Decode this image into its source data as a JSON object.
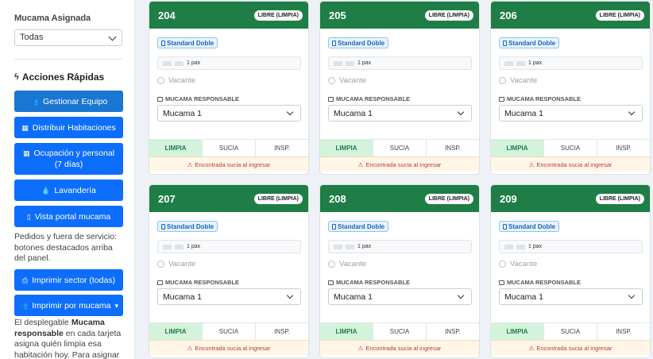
{
  "sidebar": {
    "filter_label": "Mucama Asignada",
    "filter_value": "Todas",
    "quick_actions_title": "Acciones Rápidas",
    "buttons": {
      "gestionar": "Gestionar Equipo",
      "distribuir": "Distribuir Habitaciones",
      "ocupacion_l1": "Ocupación y personal",
      "ocupacion_l2": "(7 días)",
      "lavanderia": "Lavandería",
      "portal": "Vista portal mucama",
      "imprimir_sector": "Imprimir sector (todas)",
      "imprimir_mucama": "Imprimir por mucama"
    },
    "note1": "Pedidos y fuera de servicio: botones destacados arriba del panel.",
    "note2_prefix": "El desplegable ",
    "note2_bold": "Mucama responsable",
    "note2_suffix": " en cada tarjeta asigna quién limpia esa habitación hoy. Para asignar"
  },
  "cards": [
    {
      "room": "204",
      "status": "LIBRE (LIMPIA)",
      "type": "Standard Doble",
      "pax": "1 pax",
      "vacante": "Vacante",
      "resp_label": "MUCAMA RESPONSABLE",
      "resp_value": "Mucama 1",
      "tab1": "LIMPIA",
      "tab2": "SUCIA",
      "tab3": "INSP.",
      "warning": "Encontrada sucia al ingresar"
    },
    {
      "room": "205",
      "status": "LIBRE (LIMPIA)",
      "type": "Standard Doble",
      "pax": "1 pax",
      "vacante": "Vacante",
      "resp_label": "MUCAMA RESPONSABLE",
      "resp_value": "Mucama 1",
      "tab1": "LIMPIA",
      "tab2": "SUCIA",
      "tab3": "INSP.",
      "warning": "Encontrada sucia al ingresar"
    },
    {
      "room": "206",
      "status": "LIBRE (LIMPIA)",
      "type": "Standard Doble",
      "pax": "1 pax",
      "vacante": "Vacante",
      "resp_label": "MUCAMA RESPONSABLE",
      "resp_value": "Mucama 1",
      "tab1": "LIMPIA",
      "tab2": "SUCIA",
      "tab3": "INSP.",
      "warning": "Encontrada sucia al ingresar"
    },
    {
      "room": "207",
      "status": "LIBRE (LIMPIA)",
      "type": "Standard Doble",
      "pax": "1 pax",
      "vacante": "Vacante",
      "resp_label": "MUCAMA RESPONSABLE",
      "resp_value": "Mucama 1",
      "tab1": "LIMPIA",
      "tab2": "SUCIA",
      "tab3": "INSP.",
      "warning": "Encontrada sucia al ingresar"
    },
    {
      "room": "208",
      "status": "LIBRE (LIMPIA)",
      "type": "Standard Doble",
      "pax": "1 pax",
      "vacante": "Vacante",
      "resp_label": "MUCAMA RESPONSABLE",
      "resp_value": "Mucama 1",
      "tab1": "LIMPIA",
      "tab2": "SUCIA",
      "tab3": "INSP.",
      "warning": "Encontrada sucia al ingresar"
    },
    {
      "room": "209",
      "status": "LIBRE (LIMPIA)",
      "type": "Standard Doble",
      "pax": "1 pax",
      "vacante": "Vacante",
      "resp_label": "MUCAMA RESPONSABLE",
      "resp_value": "Mucama 1",
      "tab1": "LIMPIA",
      "tab2": "SUCIA",
      "tab3": "INSP.",
      "warning": "Encontrada sucia al ingresar"
    }
  ]
}
